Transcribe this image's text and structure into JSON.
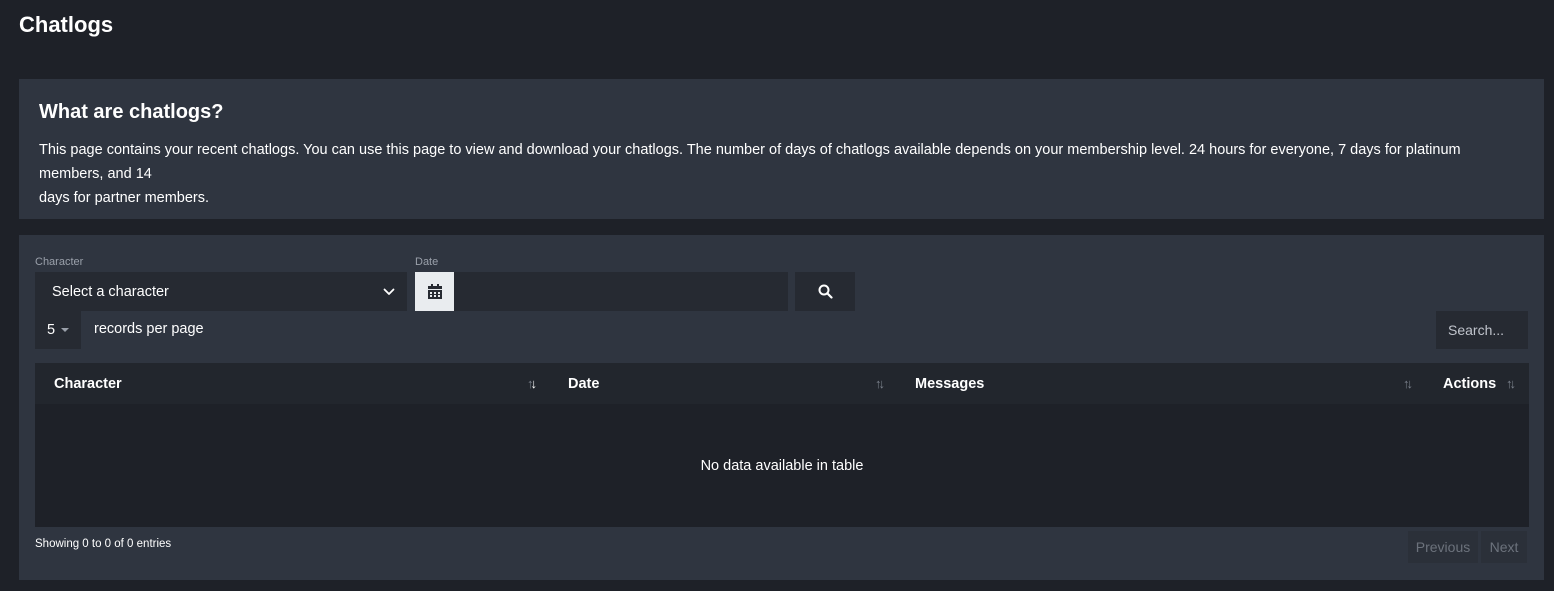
{
  "header": {
    "title": "Chatlogs"
  },
  "info": {
    "heading": "What are chatlogs?",
    "body_line1": "This page contains your recent chatlogs. You can use this page to view and download your chatlogs. The number of days of chatlogs available depends on your membership level. 24 hours for everyone, 7 days for platinum members, and 14",
    "body_line2": "days for partner members."
  },
  "filters": {
    "character_label": "Character",
    "character_value": "Select a character",
    "date_label": "Date",
    "date_value": "",
    "search_icon": "search-icon",
    "calendar_icon": "calendar-icon"
  },
  "table_controls": {
    "page_length": "5",
    "page_length_label": "records per page",
    "search_placeholder": "Search..."
  },
  "table": {
    "columns": [
      "Character",
      "Date",
      "Messages",
      "Actions"
    ],
    "empty_message": "No data available in table"
  },
  "footer": {
    "info": "Showing 0 to 0 of 0 entries",
    "previous": "Previous",
    "next": "Next"
  },
  "colors": {
    "page_bg": "#1e2128",
    "card_bg": "#2f3540",
    "input_bg": "#262a32",
    "table_header_bg": "#22262d"
  }
}
